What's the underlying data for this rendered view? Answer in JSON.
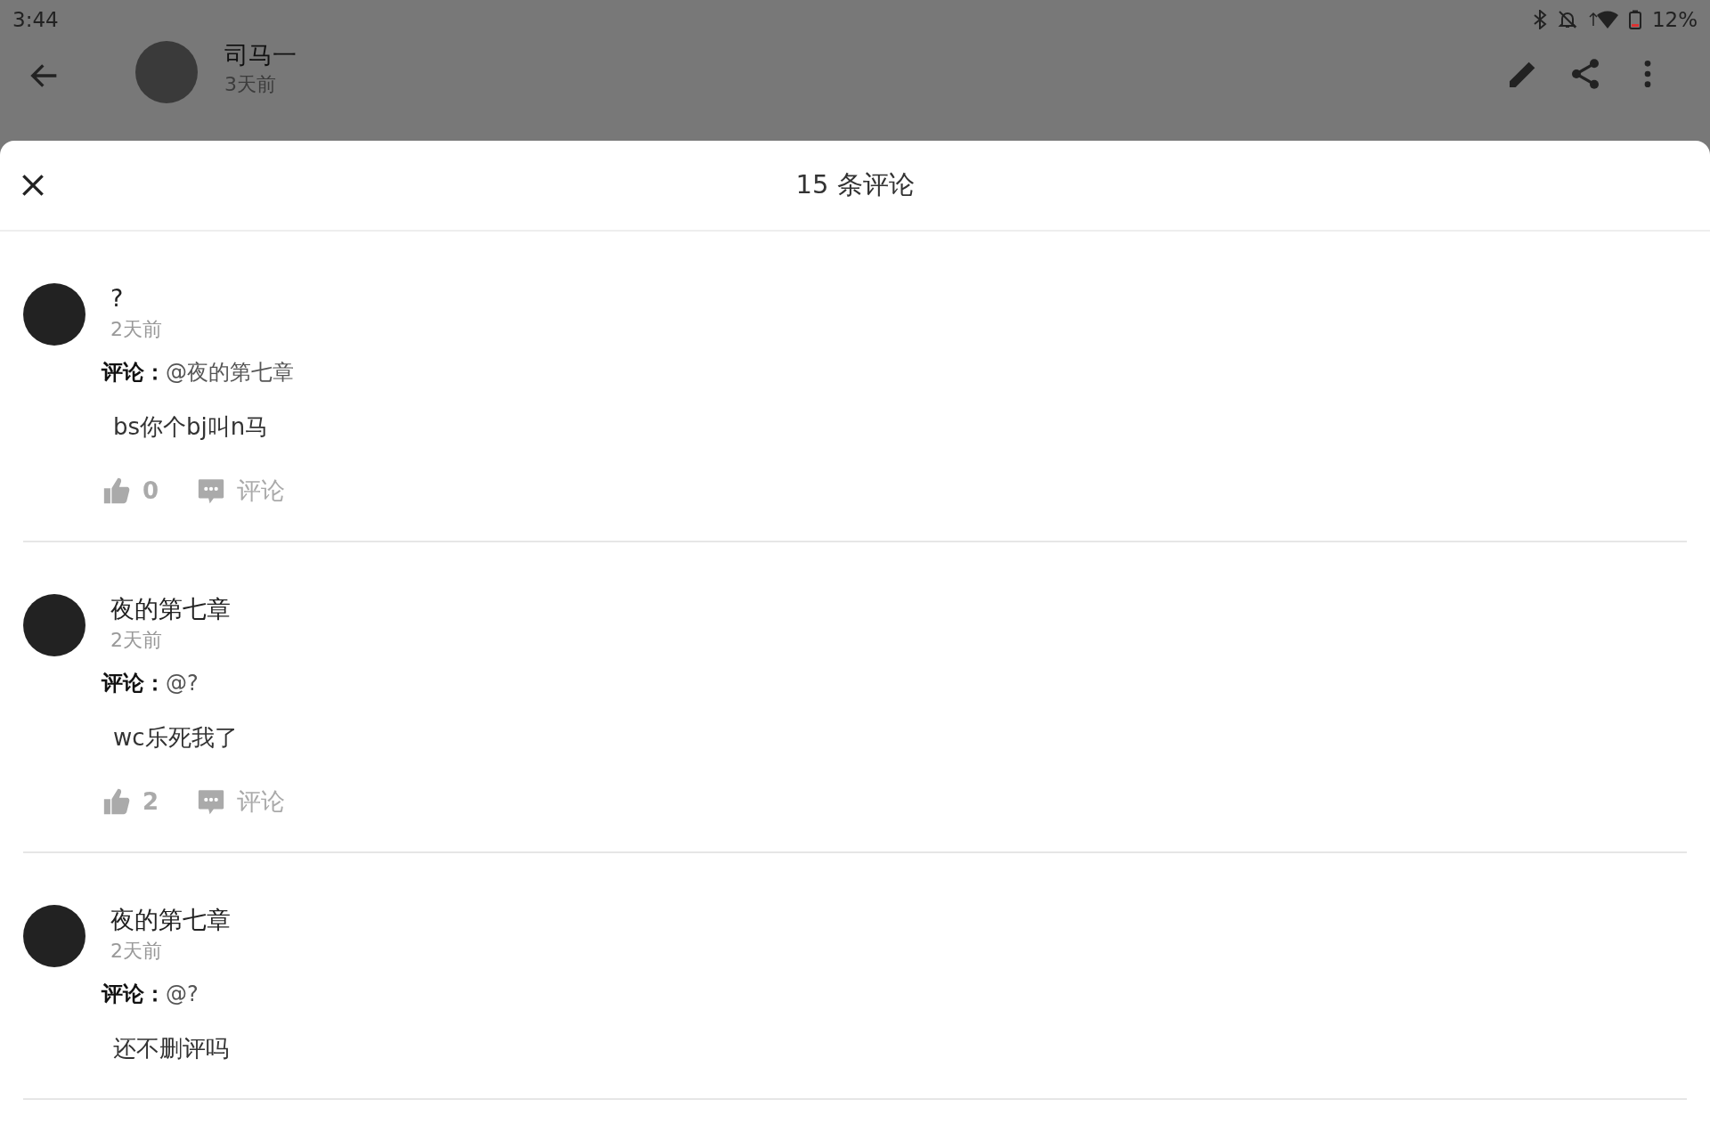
{
  "status_bar": {
    "time": "3:44",
    "battery": "12%"
  },
  "post_header": {
    "author": "司马一",
    "time": "3天前"
  },
  "sheet": {
    "title": "15 条评论",
    "comments": [
      {
        "user": "?",
        "time": "2天前",
        "reply_label": "评论：",
        "reply_to": "@夜的第七章",
        "text": "bs你个bj叫n马",
        "likes": "0",
        "reply_action": "评论"
      },
      {
        "user": "夜的第七章",
        "time": "2天前",
        "reply_label": "评论：",
        "reply_to": "@?",
        "text": "wc乐死我了",
        "likes": "2",
        "reply_action": "评论"
      },
      {
        "user": "夜的第七章",
        "time": "2天前",
        "reply_label": "评论：",
        "reply_to": "@?",
        "text": "还不删评吗"
      }
    ]
  }
}
